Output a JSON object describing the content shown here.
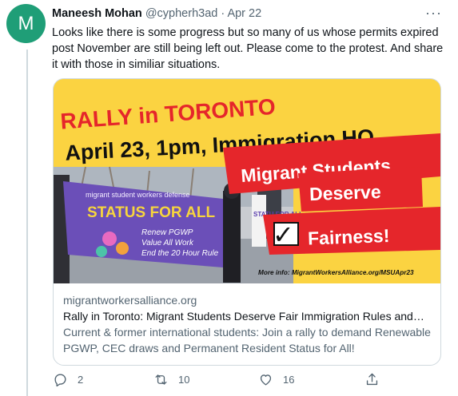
{
  "author": {
    "avatar_letter": "M",
    "name": "Maneesh Mohan",
    "handle": "@cypherh3ad",
    "separator": "·",
    "date": "Apr 22"
  },
  "more_label": "···",
  "tweet": {
    "text": "Looks like there is some progress but so many of us whose permits expired post November are still being left out. Please come to the protest. And share it with those in similiar situations."
  },
  "card": {
    "image": {
      "line1": "RALLY in TORONTO",
      "line2": "April 23, 1pm, Immigration HQ",
      "banner1": "Migrant Students",
      "banner2": "Deserve",
      "banner3": "Fairness!",
      "checkmark": "✓",
      "more_info": "More info: MigrantWorkersAlliance.org/MSUApr23",
      "flag_top": "migrant student workers defense",
      "flag_main": "STATUS FOR ALL",
      "flag_line1": "Renew PGWP",
      "flag_line2": "Value All Work",
      "flag_line3": "End the 20 Hour Rule",
      "sign_text": "STATU FOR ALL"
    },
    "domain": "migrantworkersalliance.org",
    "title": "Rally in Toronto: Migrant Students Deserve Fair Immigration Rules and…",
    "description": "Current & former international students: Join a rally to demand Renewable PGWP, CEC draws and Permanent Resident Status for All!"
  },
  "actions": {
    "reply_count": "2",
    "retweet_count": "10",
    "like_count": "16"
  },
  "colors": {
    "rally_red": "#e5262b",
    "poster_yellow": "#fbd341",
    "flag_purple": "#6b4fb8",
    "avatar_green": "#1f9e77"
  }
}
